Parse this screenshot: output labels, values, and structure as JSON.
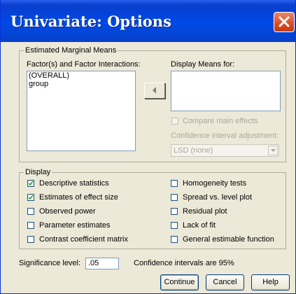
{
  "window": {
    "title": "Univariate: Options",
    "close_icon": "close-icon"
  },
  "emm": {
    "legend": "Estimated Marginal Means",
    "factors_label": "Factor(s) and Factor Interactions:",
    "factors": [
      "(OVERALL)",
      "group"
    ],
    "display_means_label": "Display Means for:",
    "compare_label": "Compare main effects",
    "ci_adjust_label": "Confidence interval adjustment:",
    "ci_adjust_value": "LSD (none)"
  },
  "display": {
    "legend": "Display",
    "left": [
      {
        "label": "Descriptive statistics",
        "checked": true
      },
      {
        "label": "Estimates of effect size",
        "checked": true
      },
      {
        "label": "Observed power",
        "checked": false
      },
      {
        "label": "Parameter estimates",
        "checked": false
      },
      {
        "label": "Contrast coefficient matrix",
        "checked": false
      }
    ],
    "right": [
      {
        "label": "Homogeneity tests",
        "checked": false
      },
      {
        "label": "Spread vs. level plot",
        "checked": false
      },
      {
        "label": "Residual plot",
        "checked": false
      },
      {
        "label": "Lack of fit",
        "checked": false
      },
      {
        "label": "General estimable function",
        "checked": false
      }
    ]
  },
  "significance": {
    "label": "Significance level:",
    "value": ".05",
    "ci_text": "Confidence intervals are 95%"
  },
  "buttons": {
    "continue": "Continue",
    "cancel": "Cancel",
    "help": "Help"
  },
  "colors": {
    "titlebar": "#0049e6",
    "close": "#d94d24",
    "face": "#ece9d8"
  }
}
